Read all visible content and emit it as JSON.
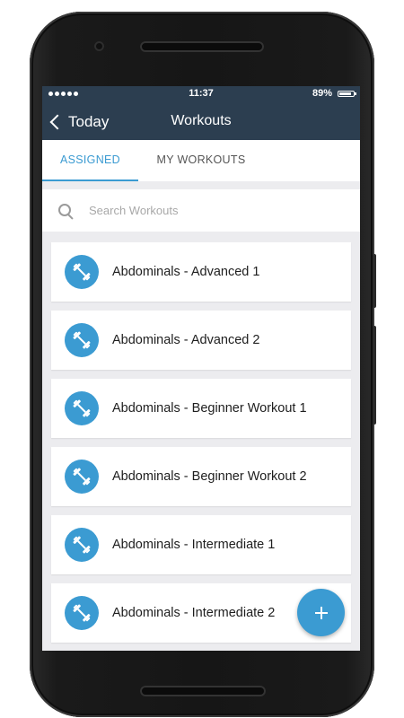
{
  "status_bar": {
    "time": "11:37",
    "battery": "89%",
    "battery_level": 0.89
  },
  "header": {
    "back_label": "Today",
    "title": "Workouts"
  },
  "tabs": [
    {
      "label": "ASSIGNED",
      "active": true
    },
    {
      "label": "MY WORKOUTS",
      "active": false
    }
  ],
  "search": {
    "placeholder": "Search Workouts",
    "value": ""
  },
  "workouts": [
    {
      "label": "Abdominals - Advanced 1",
      "icon": "dumbbell-icon"
    },
    {
      "label": "Abdominals - Advanced 2",
      "icon": "dumbbell-icon"
    },
    {
      "label": "Abdominals - Beginner Workout 1",
      "icon": "dumbbell-icon"
    },
    {
      "label": "Abdominals - Beginner Workout 2",
      "icon": "dumbbell-icon"
    },
    {
      "label": "Abdominals - Intermediate 1",
      "icon": "dumbbell-icon"
    },
    {
      "label": "Abdominals - Intermediate 2",
      "icon": "dumbbell-icon"
    }
  ],
  "fab": {
    "icon": "plus-icon"
  },
  "colors": {
    "header_bg": "#2c3e50",
    "accent": "#3b9bd2",
    "list_bg": "#ececef"
  }
}
